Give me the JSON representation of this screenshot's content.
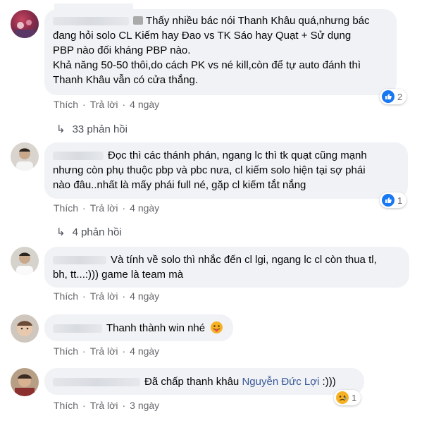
{
  "comments": [
    {
      "text_lines": [
        "Thấy nhiều bác nói Thanh Khâu quá,nhưng bác",
        "đang hỏi solo CL Kiếm hay Đao vs TK Sáo hay Quạt + Sử dụng",
        "PBP nào đối kháng PBP nào.",
        "Khả năng 50-50 thôi,do cách PK vs né kill,còn để tự auto đánh thì",
        "Thanh Khâu vẫn có cửa thắng."
      ],
      "like": "Thích",
      "reply": "Trả lời",
      "time": "4 ngày",
      "reaction": "like",
      "reaction_count": "2",
      "replies": "33 phản hồi"
    },
    {
      "text_lines": [
        "Đọc thì các thánh phán, ngang lc thì tk quạt cũng mạnh",
        "nhưng còn phụ thuộc pbp và pbc nưa, cl kiếm solo hiện tại sợ phái",
        "nào đâu..nhất là mấy phái full né, gặp cl kiếm tắt nắng"
      ],
      "like": "Thích",
      "reply": "Trả lời",
      "time": "4 ngày",
      "reaction": "like",
      "reaction_count": "1",
      "replies": "4 phản hồi"
    },
    {
      "text_lines": [
        "Và tính về solo thì nhắc đến cl lgi, ngang lc cl còn thua tl,",
        "bh, tt...:))) game là team mà"
      ],
      "like": "Thích",
      "reply": "Trả lời",
      "time": "4 ngày"
    },
    {
      "text": "Thanh thành win nhé",
      "emoji": "tongue-emoji",
      "like": "Thích",
      "reply": "Trả lời",
      "time": "4 ngày"
    },
    {
      "text": "Đã chấp thanh khâu",
      "mention": "Nguyễn Đức Lợi",
      "text_after": ":)))",
      "like": "Thích",
      "reply": "Trả lời",
      "time": "3 ngày",
      "reaction": "sad",
      "reaction_count": "1"
    }
  ],
  "colors": {
    "bubble": "#f0f2f5",
    "link": "#65676b",
    "mention": "#385898",
    "like_blue": "#1877f2",
    "emoji_yellow": "#f7b125"
  }
}
